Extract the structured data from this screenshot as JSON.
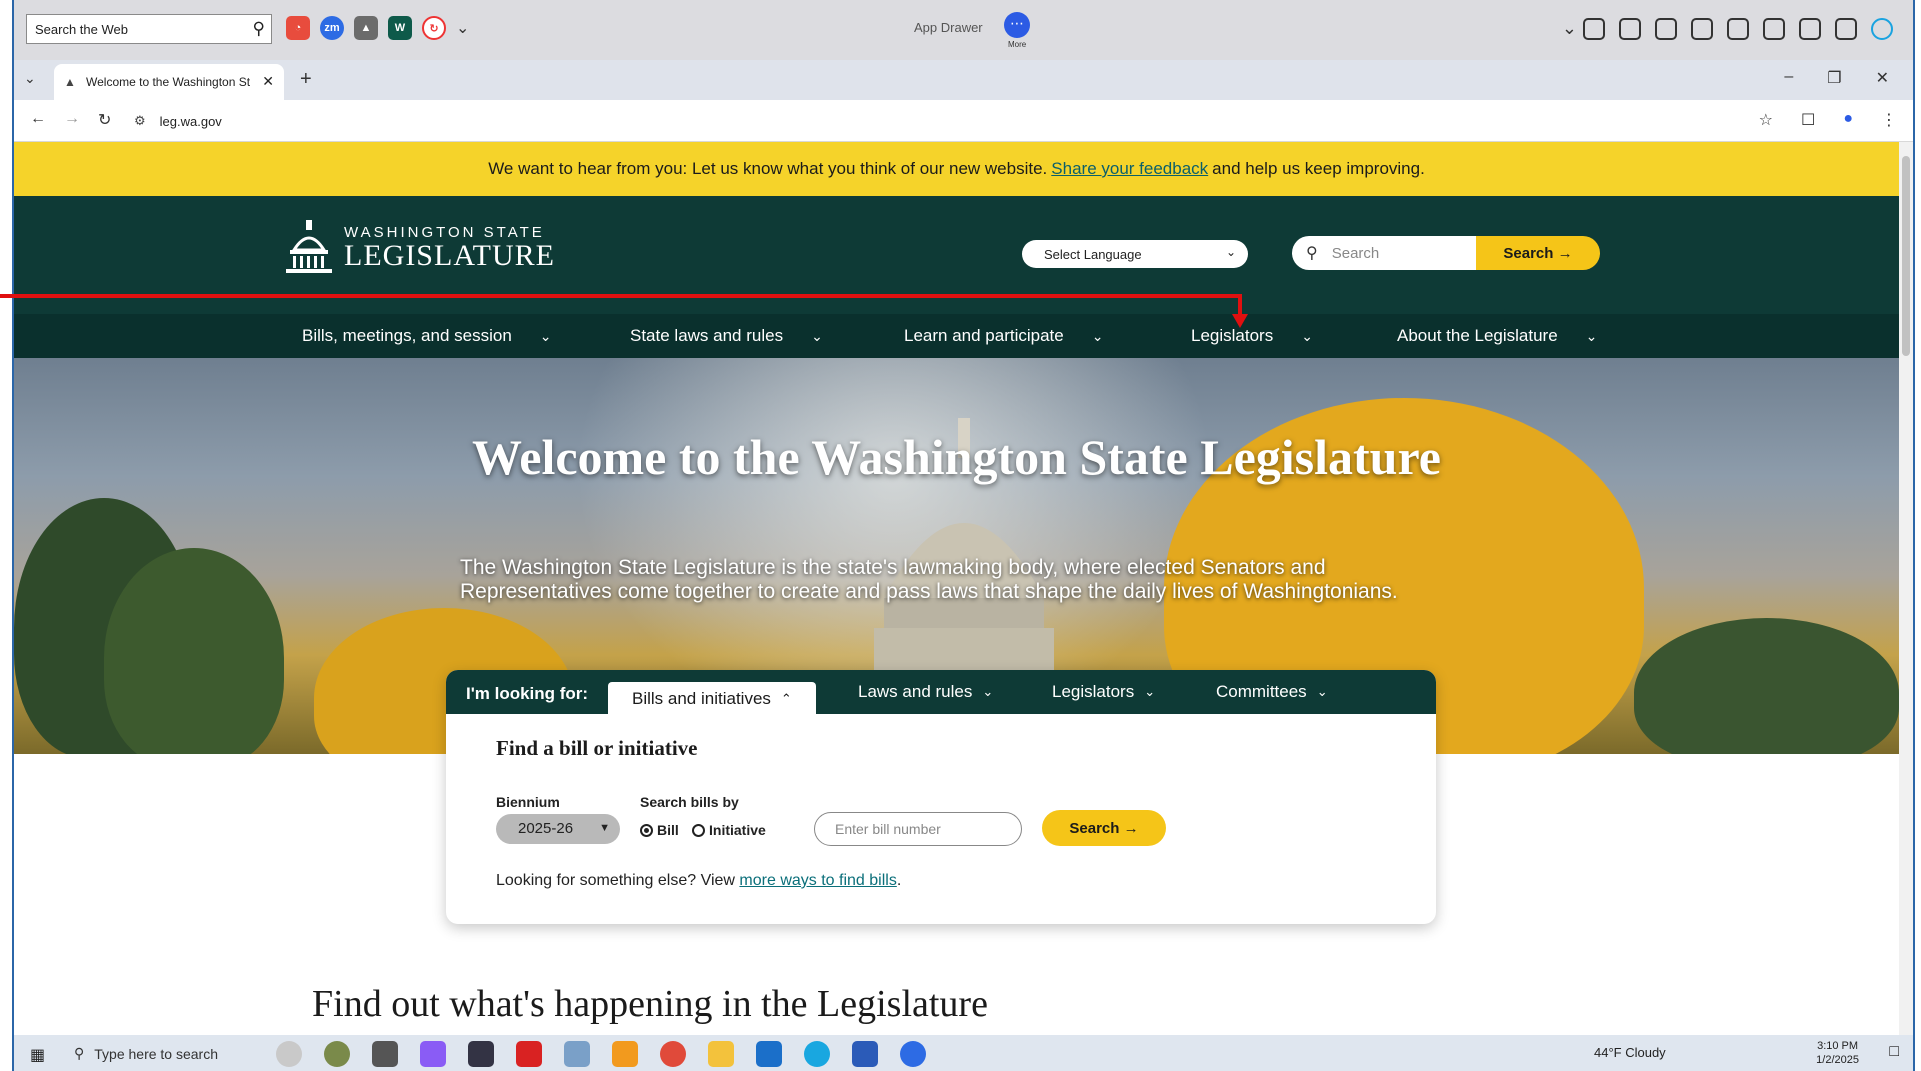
{
  "appbar": {
    "web_search_value": "Search the Web",
    "app_drawer_label": "App Drawer",
    "more_label": "More"
  },
  "browser": {
    "tab_title": "Welcome to the Washington St",
    "url": "leg.wa.gov"
  },
  "banner": {
    "text_before": "We want to hear from you: Let us know what you think of our new website.",
    "link_text": "Share your feedback",
    "text_after": "and help us keep improving."
  },
  "header": {
    "logo_line1": "WASHINGTON STATE",
    "logo_line2": "LEGISLATURE",
    "language_select": "Select Language",
    "search_placeholder": "Search",
    "search_button": "Search →"
  },
  "nav": {
    "items": [
      {
        "label": "Bills, meetings, and session"
      },
      {
        "label": "State laws and rules"
      },
      {
        "label": "Learn and participate"
      },
      {
        "label": "Legislators"
      },
      {
        "label": "About the Legislature"
      }
    ]
  },
  "hero": {
    "title": "Welcome to the Washington State Legislature",
    "description": "The Washington State Legislature is the state's lawmaking body, where elected Senators and Representatives come together to create and pass laws that shape the daily lives of Washingtonians."
  },
  "finder": {
    "looking_for": "I'm looking for:",
    "tabs": [
      {
        "label": "Bills and initiatives"
      },
      {
        "label": "Laws and rules"
      },
      {
        "label": "Legislators"
      },
      {
        "label": "Committees"
      }
    ],
    "heading": "Find a bill or initiative",
    "biennium_label": "Biennium",
    "biennium_value": "2025-26",
    "search_by_label": "Search bills by",
    "radio_bill": "Bill",
    "radio_initiative": "Initiative",
    "bill_placeholder": "Enter bill number",
    "search_button": "Search →",
    "more_text": "Looking for something else? View",
    "more_link": "more ways to find bills"
  },
  "section": {
    "happening_title": "Find out what's happening in the Legislature"
  },
  "taskbar": {
    "search_placeholder": "Type here to search",
    "weather": "44°F  Cloudy",
    "time": "3:10 PM",
    "date": "1/2/2025"
  },
  "colors": {
    "banner_yellow": "#f5d32a",
    "header_green": "#0e3a36",
    "button_yellow": "#f5c518",
    "annotation_red": "#e01010"
  }
}
